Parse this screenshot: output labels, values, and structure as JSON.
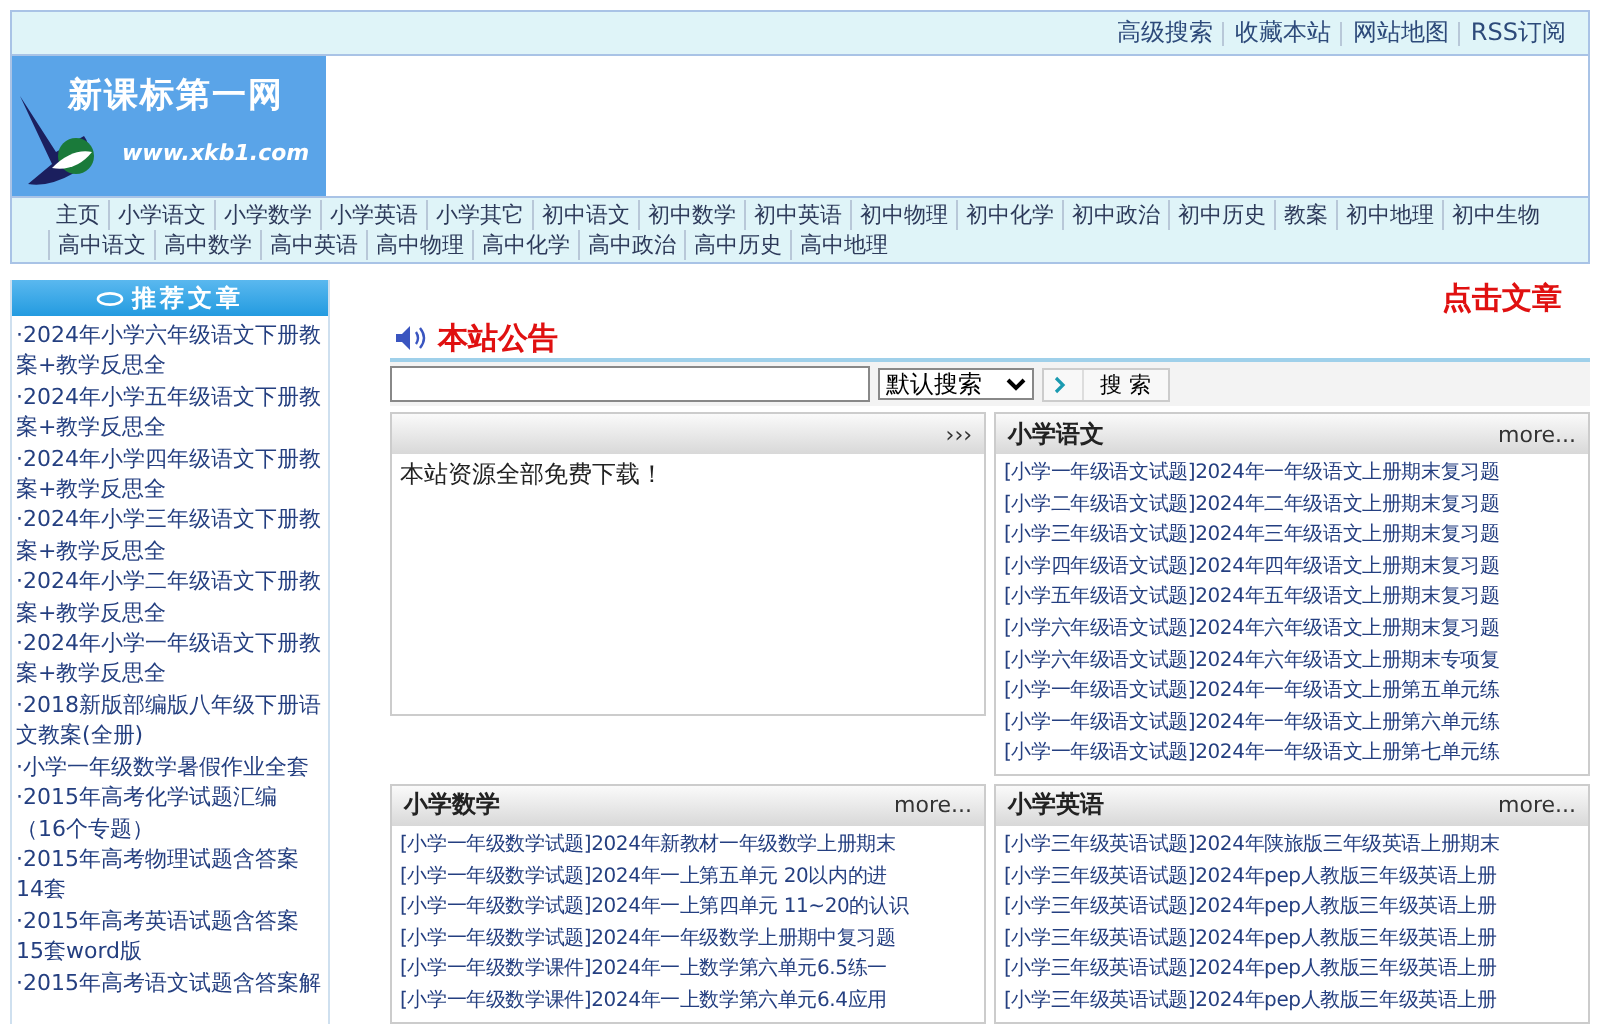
{
  "top_links": [
    "高级搜索",
    "收藏本站",
    "网站地图",
    "RSS订阅"
  ],
  "logo": {
    "title": "新课标第一网",
    "url": "www.xkb1.com"
  },
  "nav": [
    "主页",
    "小学语文",
    "小学数学",
    "小学英语",
    "小学其它",
    "初中语文",
    "初中数学",
    "初中英语",
    "初中物理",
    "初中化学",
    "初中政治",
    "初中历史",
    "教案",
    "初中地理",
    "初中生物",
    "高中语文",
    "高中数学",
    "高中英语",
    "高中物理",
    "高中化学",
    "高中政治",
    "高中历史",
    "高中地理"
  ],
  "sidebar": {
    "title": "推荐文章",
    "items": [
      "·2024年小学六年级语文下册教案+教学反思全",
      "·2024年小学五年级语文下册教案+教学反思全",
      "·2024年小学四年级语文下册教案+教学反思全",
      "·2024年小学三年级语文下册教案+教学反思全",
      "·2024年小学二年级语文下册教案+教学反思全",
      "·2024年小学一年级语文下册教案+教学反思全",
      "·2018新版部编版八年级下册语文教案(全册)",
      "·小学一年级数学暑假作业全套",
      "·2015年高考化学试题汇编（16个专题）",
      "·2015年高考物理试题含答案14套",
      "·2015年高考英语试题含答案15套word版",
      "·2015年高考语文试题含答案解"
    ]
  },
  "click_articles": "点击文章",
  "notice_title": "本站公告",
  "search": {
    "select": "默认搜索",
    "button": "搜 索"
  },
  "panels": [
    {
      "more": "›››",
      "text": "本站资源全部免费下载！"
    },
    {
      "title": "小学语文",
      "more": "more...",
      "links": [
        "[小学一年级语文试题]2024年一年级语文上册期末复习题",
        "[小学二年级语文试题]2024年二年级语文上册期末复习题",
        "[小学三年级语文试题]2024年三年级语文上册期末复习题",
        "[小学四年级语文试题]2024年四年级语文上册期末复习题",
        "[小学五年级语文试题]2024年五年级语文上册期末复习题",
        "[小学六年级语文试题]2024年六年级语文上册期末复习题",
        "[小学六年级语文试题]2024年六年级语文上册期末专项复",
        "[小学一年级语文试题]2024年一年级语文上册第五单元练",
        "[小学一年级语文试题]2024年一年级语文上册第六单元练",
        "[小学一年级语文试题]2024年一年级语文上册第七单元练"
      ]
    },
    {
      "title": "小学数学",
      "more": "more...",
      "links": [
        "[小学一年级数学试题]2024年新教材一年级数学上册期末",
        "[小学一年级数学试题]2024年一上第五单元 20以内的进",
        "[小学一年级数学试题]2024年一上第四单元 11~20的认识",
        "[小学一年级数学试题]2024年一年级数学上册期中复习题",
        "[小学一年级数学课件]2024年一上数学第六单元6.5练一",
        "[小学一年级数学课件]2024年一上数学第六单元6.4应用"
      ]
    },
    {
      "title": "小学英语",
      "more": "more...",
      "links": [
        "[小学三年级英语试题]2024年陕旅版三年级英语上册期末",
        "[小学三年级英语试题]2024年pep人教版三年级英语上册",
        "[小学三年级英语试题]2024年pep人教版三年级英语上册",
        "[小学三年级英语试题]2024年pep人教版三年级英语上册",
        "[小学三年级英语试题]2024年pep人教版三年级英语上册",
        "[小学三年级英语试题]2024年pep人教版三年级英语上册"
      ]
    }
  ]
}
